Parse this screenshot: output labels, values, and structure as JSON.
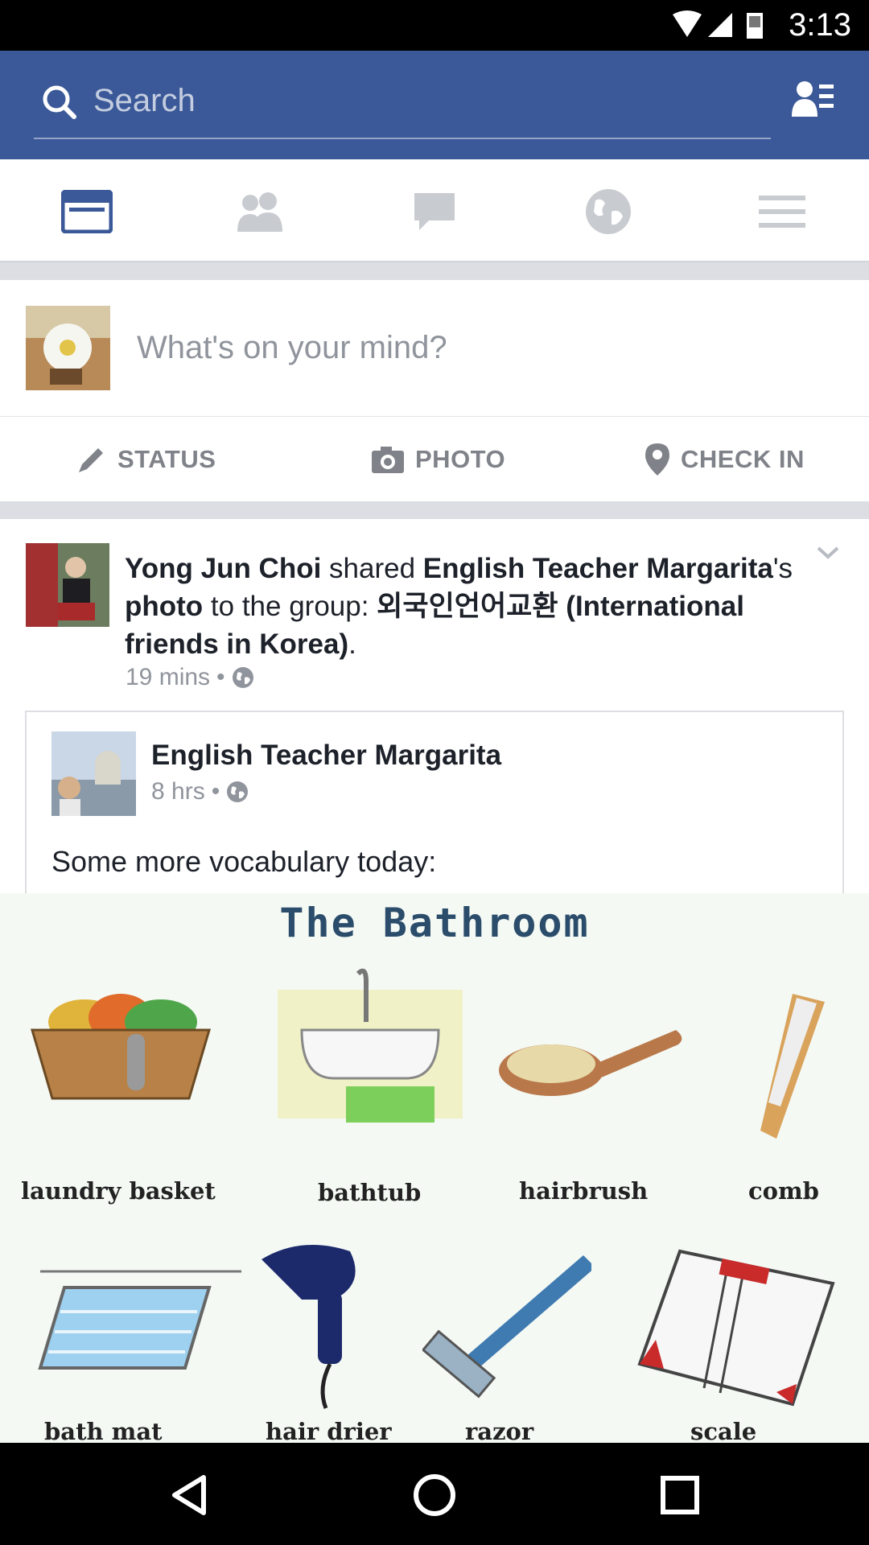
{
  "status_bar": {
    "time": "3:13"
  },
  "search": {
    "placeholder": "Search"
  },
  "nav_tabs": [
    {
      "name": "news-feed",
      "active": true
    },
    {
      "name": "friend-requests",
      "active": false
    },
    {
      "name": "messages",
      "active": false
    },
    {
      "name": "notifications",
      "active": false
    },
    {
      "name": "more",
      "active": false
    }
  ],
  "composer": {
    "placeholder": "What's on your mind?",
    "actions": [
      {
        "label": "STATUS",
        "icon": "pencil-icon"
      },
      {
        "label": "PHOTO",
        "icon": "camera-icon"
      },
      {
        "label": "CHECK IN",
        "icon": "location-pin-icon"
      }
    ]
  },
  "post": {
    "actor": "Yong Jun Choi",
    "verb": " shared ",
    "owner": "English Teacher Margarita",
    "owner_suffix": "'s ",
    "object": "photo",
    "to_group": " to the group: ",
    "group": "외국인언어교환 (International friends in Korea)",
    "end": ".",
    "time": "19 mins",
    "shared": {
      "name": "English Teacher Margarita",
      "time": "8 hrs",
      "text": "Some more vocabulary today:"
    }
  },
  "vocab_image": {
    "title": "The Bathroom",
    "items": [
      "laundry basket",
      "bathtub",
      "hairbrush",
      "comb",
      "bath mat",
      "hair drier",
      "razor",
      "scale"
    ]
  },
  "colors": {
    "brand": "#3b5998",
    "muted": "#90949c"
  }
}
